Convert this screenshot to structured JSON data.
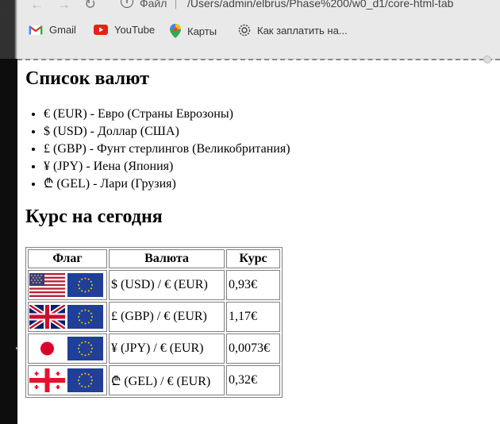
{
  "browser": {
    "url_scheme": "Файл",
    "url": "/Users/admin/elbrus/Phase%200/w0_d1/core-html-tab",
    "bookmarks": [
      {
        "label": "Gmail",
        "icon": "gmail-icon"
      },
      {
        "label": "YouTube",
        "icon": "youtube-icon"
      },
      {
        "label": "Карты",
        "icon": "maps-icon"
      },
      {
        "label": "Как заплатить на...",
        "icon": "payment-icon"
      }
    ]
  },
  "page": {
    "currencies_heading": "Список валют",
    "currencies": [
      "€ (EUR) - Евро (Страны Еврозоны)",
      "$ (USD) - Доллар (США)",
      "£ (GBP) - Фунт стерлингов (Великобритания)",
      "¥ (JPY) - Иена (Япония)",
      "₾ (GEL) - Лари (Грузия)"
    ],
    "rates_heading": "Курс на сегодня",
    "table": {
      "headers": [
        "Флаг",
        "Валюта",
        "Курс"
      ],
      "rows": [
        {
          "flags": [
            "us-flag",
            "eu-flag"
          ],
          "pair": "$ (USD) / € (EUR)",
          "rate": "0,93€"
        },
        {
          "flags": [
            "uk-flag",
            "eu-flag"
          ],
          "pair": "£ (GBP) / € (EUR)",
          "rate": "1,17€"
        },
        {
          "flags": [
            "japan-flag",
            "eu-flag"
          ],
          "pair": "¥ (JPY) / € (EUR)",
          "rate": "0,0073€"
        },
        {
          "flags": [
            "georgia-flag",
            "eu-flag"
          ],
          "pair": "₾ (GEL) / € (EUR)",
          "rate": "0,32€"
        }
      ]
    }
  }
}
